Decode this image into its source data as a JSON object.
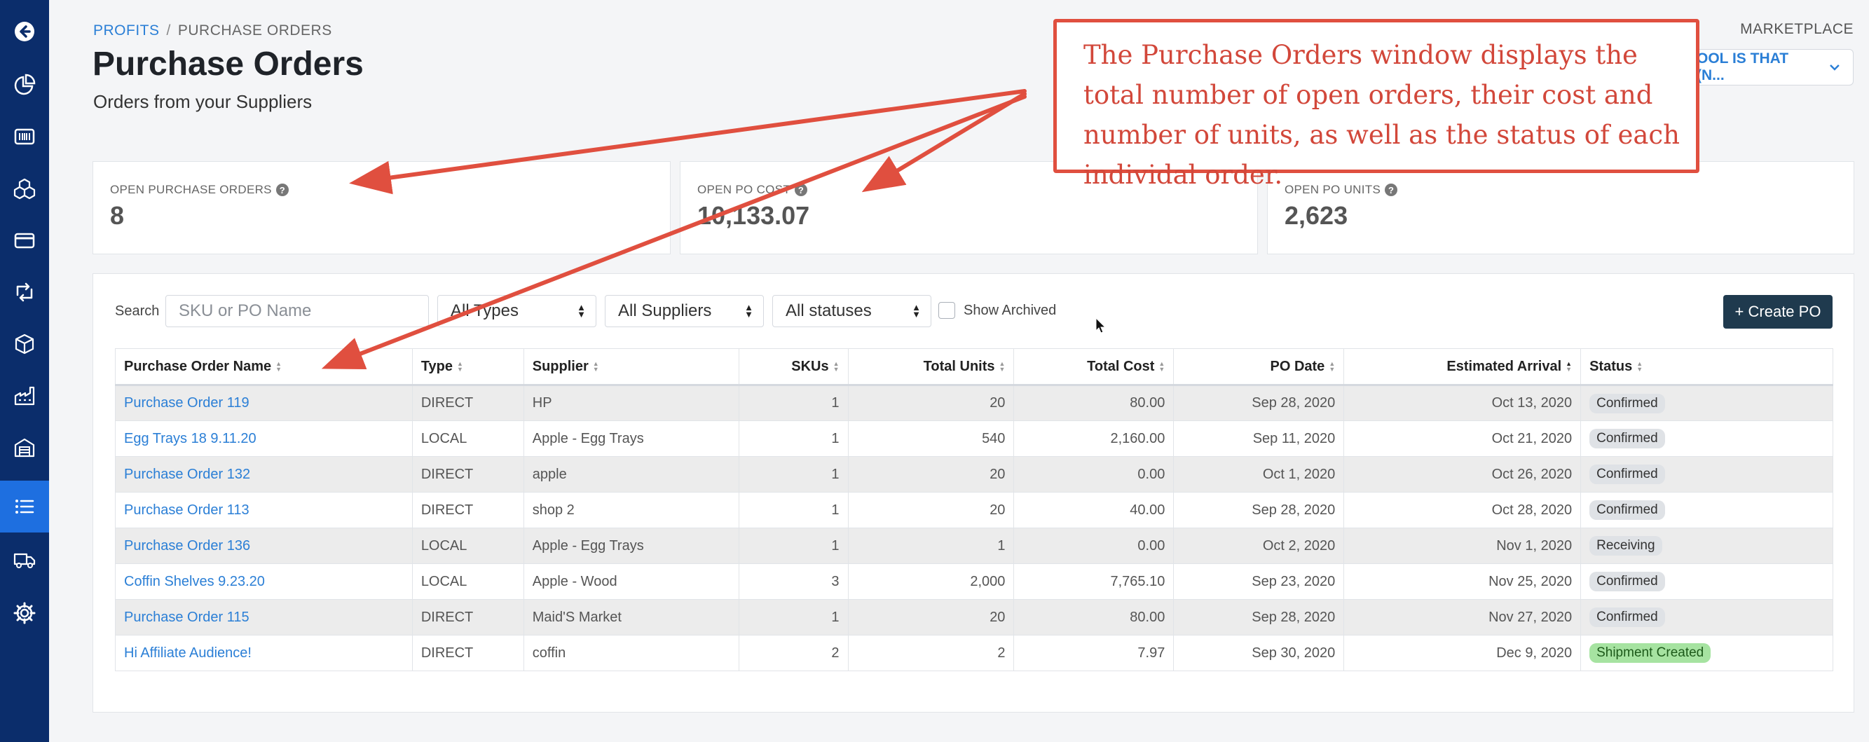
{
  "breadcrumb": {
    "parent": "PROFITS",
    "separator": "/",
    "current": "PURCHASE ORDERS"
  },
  "header": {
    "title": "Purchase Orders",
    "subtitle": "Orders from your Suppliers",
    "marketplace_label": "MARKETPLACE",
    "store_value": "OOL IS THAT (N..."
  },
  "sidebar": {
    "items": [
      {
        "icon": "back-arrow-icon"
      },
      {
        "icon": "pie-chart-icon"
      },
      {
        "icon": "barcode-icon"
      },
      {
        "icon": "cubes-icon"
      },
      {
        "icon": "credit-card-icon"
      },
      {
        "icon": "repeat-icon"
      },
      {
        "icon": "box-icon"
      },
      {
        "icon": "industry-icon"
      },
      {
        "icon": "warehouse-icon"
      },
      {
        "icon": "list-icon",
        "active": true
      },
      {
        "icon": "truck-icon"
      },
      {
        "icon": "gear-icon"
      }
    ]
  },
  "stats": [
    {
      "label": "OPEN PURCHASE ORDERS",
      "value": "8"
    },
    {
      "label": "OPEN PO COST",
      "value": "10,133.07"
    },
    {
      "label": "OPEN PO UNITS",
      "value": "2,623"
    }
  ],
  "filters": {
    "search_label": "Search",
    "search_placeholder": "SKU or PO Name",
    "types": "All Types",
    "suppliers": "All Suppliers",
    "statuses": "All statuses",
    "show_archived": "Show Archived",
    "create_button": "+ Create PO"
  },
  "table": {
    "columns": [
      "Purchase Order Name",
      "Type",
      "Supplier",
      "SKUs",
      "Total Units",
      "Total Cost",
      "PO Date",
      "Estimated Arrival",
      "Status"
    ],
    "rows": [
      [
        "Purchase Order 119",
        "DIRECT",
        "HP",
        "1",
        "20",
        "80.00",
        "Sep 28, 2020",
        "Oct 13, 2020",
        "Confirmed"
      ],
      [
        "Egg Trays 18 9.11.20",
        "LOCAL",
        "Apple - Egg Trays",
        "1",
        "540",
        "2,160.00",
        "Sep 11, 2020",
        "Oct 21, 2020",
        "Confirmed"
      ],
      [
        "Purchase Order 132",
        "DIRECT",
        "apple",
        "1",
        "20",
        "0.00",
        "Oct 1, 2020",
        "Oct 26, 2020",
        "Confirmed"
      ],
      [
        "Purchase Order 113",
        "DIRECT",
        "shop 2",
        "1",
        "20",
        "40.00",
        "Sep 28, 2020",
        "Oct 28, 2020",
        "Confirmed"
      ],
      [
        "Purchase Order 136",
        "LOCAL",
        "Apple - Egg Trays",
        "1",
        "1",
        "0.00",
        "Oct 2, 2020",
        "Nov 1, 2020",
        "Receiving"
      ],
      [
        "Coffin Shelves 9.23.20",
        "LOCAL",
        "Apple - Wood",
        "3",
        "2,000",
        "7,765.10",
        "Sep 23, 2020",
        "Nov 25, 2020",
        "Confirmed"
      ],
      [
        "Purchase Order 115",
        "DIRECT",
        "Maid'S Market",
        "1",
        "20",
        "80.00",
        "Sep 28, 2020",
        "Nov 27, 2020",
        "Confirmed"
      ],
      [
        "Hi Affiliate Audience!",
        "DIRECT",
        "coffin",
        "2",
        "2",
        "7.97",
        "Sep 30, 2020",
        "Dec 9, 2020",
        "Shipment Created"
      ]
    ]
  },
  "annotation": {
    "text": "The Purchase Orders window displays the total number of open orders, their cost and number of units, as well as the status of each individal order."
  },
  "colors": {
    "sidebar": "#0b2d6b",
    "sidebar_active": "#1e6fe0",
    "link": "#2b7fd6",
    "annotation": "#e04f3f",
    "create_button": "#1f3a4e",
    "badge_green": "#a6e3a1"
  }
}
